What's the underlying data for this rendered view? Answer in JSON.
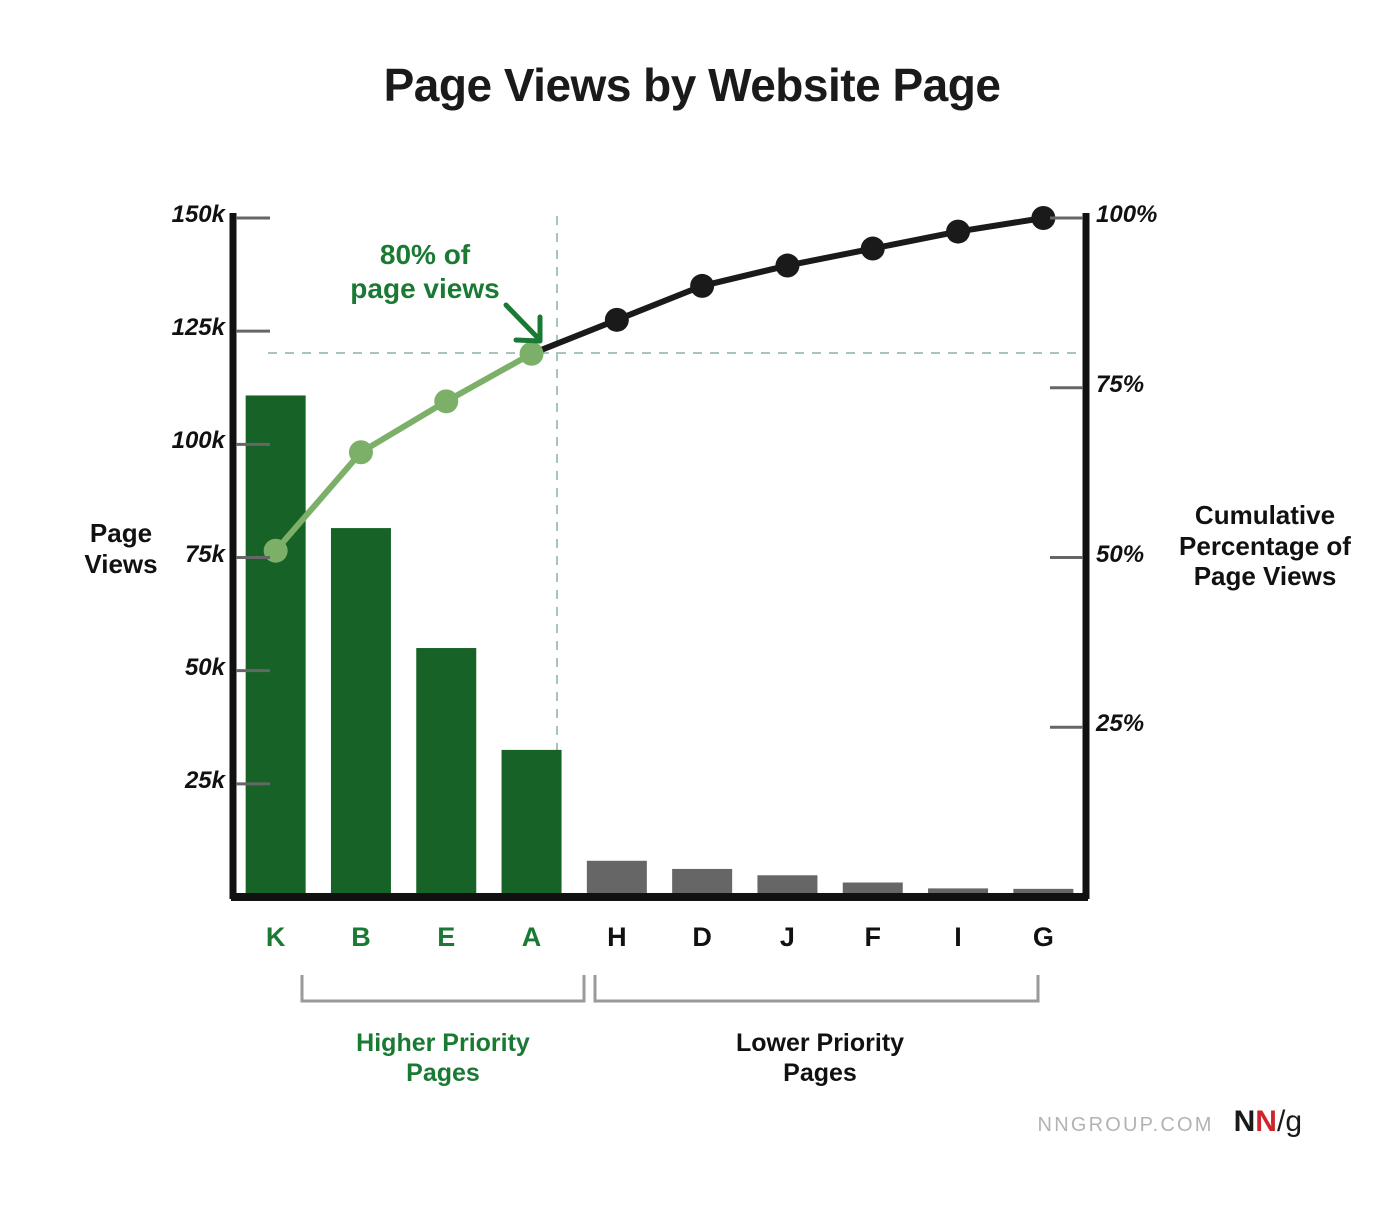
{
  "title": "Page Views by Website Page",
  "axes": {
    "left_title": "Page\nViews",
    "left_title_line1": "Page",
    "left_title_line2": "Views",
    "right_title_line1": "Cumulative",
    "right_title_line2": "Percentage of",
    "right_title_line3": "Page Views"
  },
  "annotation": {
    "line1": "80% of",
    "line2": "page views"
  },
  "groups": {
    "high_line1": "Higher Priority",
    "high_line2": "Pages",
    "low_line1": "Lower Priority",
    "low_line2": "Pages"
  },
  "footer": {
    "site": "NNGROUP.COM",
    "mark_n1": "N",
    "mark_n2": "N",
    "mark_slash": "/",
    "mark_g": "g"
  },
  "colors": {
    "bar_high": "#166227",
    "bar_low": "#666666",
    "cum_high": "#7cb069",
    "cum_low": "#1a1a1a",
    "accent_green": "#1a7a33",
    "guide": "#a8c4bd"
  },
  "chart_data": {
    "type": "bar",
    "title": "Page Views by Website Page",
    "xlabel": "",
    "ylabel": "Page Views",
    "y2label": "Cumulative Percentage of Page Views",
    "categories": [
      "K",
      "B",
      "E",
      "A",
      "H",
      "D",
      "J",
      "F",
      "I",
      "G"
    ],
    "series": [
      {
        "name": "Page Views",
        "type": "bar",
        "values": [
          110800,
          81500,
          55000,
          32500,
          8000,
          6200,
          4800,
          3200,
          1900,
          1800
        ],
        "colors": [
          "#166227",
          "#166227",
          "#166227",
          "#166227",
          "#666666",
          "#666666",
          "#666666",
          "#666666",
          "#666666",
          "#666666"
        ]
      },
      {
        "name": "Cumulative Percentage of Page Views",
        "type": "line",
        "axis": "right",
        "values": [
          51,
          65.5,
          73,
          80,
          85,
          90,
          93,
          95.5,
          98,
          100
        ],
        "point_colors": [
          "#7cb069",
          "#7cb069",
          "#7cb069",
          "#7cb069",
          "#1a1a1a",
          "#1a1a1a",
          "#1a1a1a",
          "#1a1a1a",
          "#1a1a1a",
          "#1a1a1a"
        ]
      }
    ],
    "ylim": [
      0,
      150000
    ],
    "yticks": [
      25000,
      50000,
      75000,
      100000,
      125000,
      150000
    ],
    "ytick_labels": [
      "25k",
      "50k",
      "75k",
      "100k",
      "125k",
      "150k"
    ],
    "y2lim": [
      0,
      100
    ],
    "y2ticks": [
      25,
      50,
      75,
      100
    ],
    "y2tick_labels": [
      "25%",
      "50%",
      "75%",
      "100%"
    ],
    "grid": false,
    "legend": "none",
    "annotations": [
      {
        "text": "80% of page views",
        "target_category": "A",
        "target_value": 80
      },
      {
        "text": "Higher Priority Pages",
        "categories": [
          "K",
          "B",
          "E",
          "A"
        ]
      },
      {
        "text": "Lower Priority Pages",
        "categories": [
          "H",
          "D",
          "J",
          "F",
          "I",
          "G"
        ]
      }
    ],
    "reference_lines": [
      {
        "orientation": "horizontal",
        "value": 80,
        "axis": "right",
        "style": "dashed"
      },
      {
        "orientation": "vertical",
        "category": "A",
        "style": "dashed"
      }
    ]
  }
}
